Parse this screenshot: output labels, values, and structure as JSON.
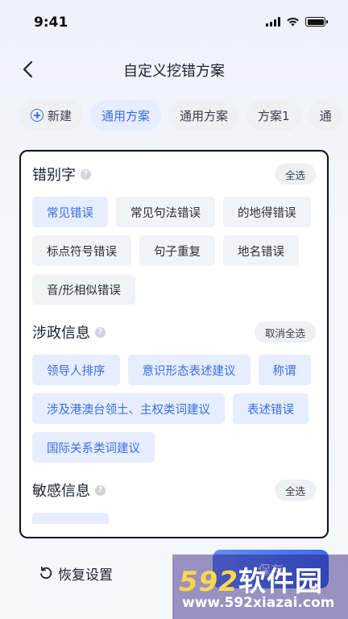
{
  "status": {
    "time": "9:41"
  },
  "header": {
    "title": "自定义挖错方案"
  },
  "tabs": [
    {
      "label": "新建"
    },
    {
      "label": "通用方案"
    },
    {
      "label": "通用方案"
    },
    {
      "label": "方案1"
    },
    {
      "label": "通"
    }
  ],
  "sections": [
    {
      "title": "错别字",
      "action": "全选",
      "chips": [
        "常见错误",
        "常见句法错误",
        "的地得错误",
        "标点符号错误",
        "句子重复",
        "地名错误",
        "音/形相似错误"
      ]
    },
    {
      "title": "涉政信息",
      "action": "取消全选",
      "chips": [
        "领导人排序",
        "意识形态表述建议",
        "称谓",
        "涉及港澳台领土、主权类词建议",
        "表述错误",
        "国际关系类词建议"
      ]
    },
    {
      "title": "敏感信息",
      "action": "全选",
      "chips": []
    }
  ],
  "bottom": {
    "reset_label": "恢复设置",
    "confirm_label": "保存"
  },
  "watermark": {
    "brand_num": "592",
    "brand_cn": "软件园",
    "url": "www.592xiazai.com"
  },
  "colors": {
    "accent": "#3a6ee8",
    "chip_bg": "#f2f3f6",
    "selected_bg": "#e6edfc"
  }
}
